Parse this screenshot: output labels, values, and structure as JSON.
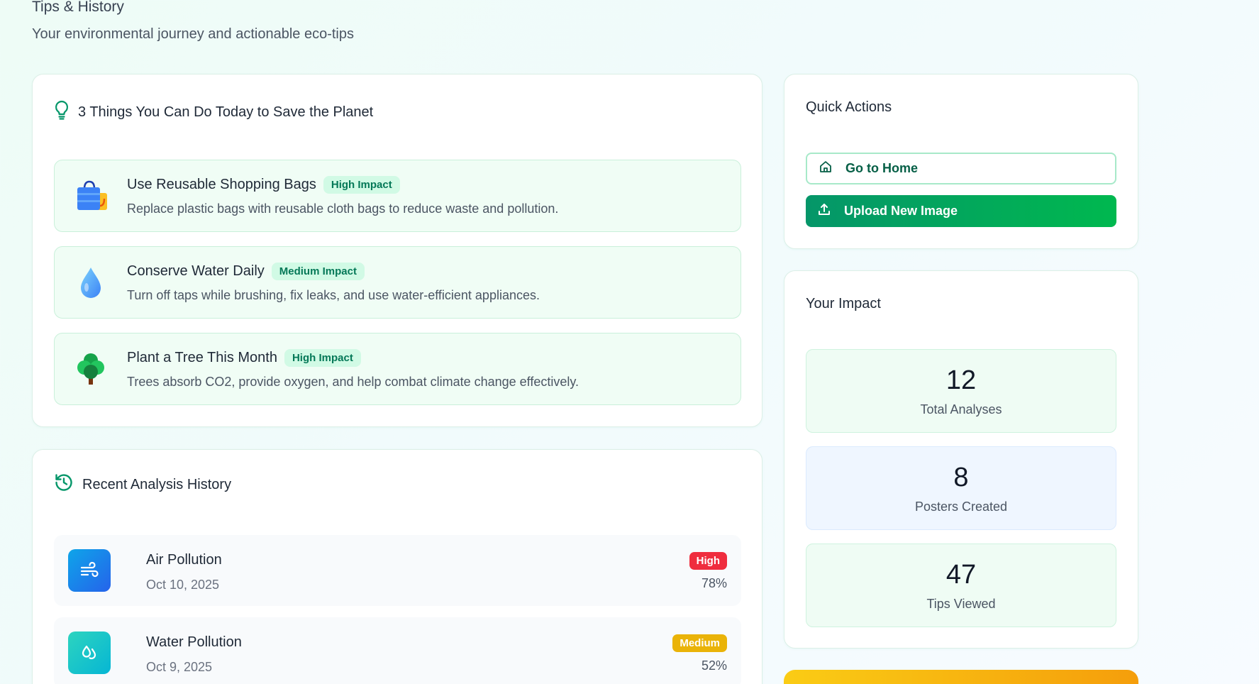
{
  "header": {
    "title": "Tips & History",
    "subtitle": "Your environmental journey and actionable eco-tips"
  },
  "tips": {
    "title": "3 Things You Can Do Today to Save the Planet",
    "items": [
      {
        "icon": "shopping-bags-icon",
        "title": "Use Reusable Shopping Bags",
        "badge": "High Impact",
        "description": "Replace plastic bags with reusable cloth bags to reduce waste and pollution."
      },
      {
        "icon": "water-drop-icon",
        "title": "Conserve Water Daily",
        "badge": "Medium Impact",
        "description": "Turn off taps while brushing, fix leaks, and use water-efficient appliances."
      },
      {
        "icon": "tree-icon",
        "title": "Plant a Tree This Month",
        "badge": "High Impact",
        "description": "Trees absorb CO2, provide oxygen, and help combat climate change effectively."
      }
    ]
  },
  "history": {
    "title": "Recent Analysis History",
    "items": [
      {
        "icon": "wind-icon",
        "name": "Air Pollution",
        "date": "Oct 10, 2025",
        "severity": "High",
        "severity_color": "#ef2d3e",
        "percent": "78%"
      },
      {
        "icon": "droplets-icon",
        "name": "Water Pollution",
        "date": "Oct 9, 2025",
        "severity": "Medium",
        "severity_color": "#eab308",
        "percent": "52%"
      }
    ]
  },
  "quick_actions": {
    "title": "Quick Actions",
    "home_label": "Go to Home",
    "upload_label": "Upload New Image"
  },
  "impact": {
    "title": "Your Impact",
    "stats": [
      {
        "value": "12",
        "label": "Total Analyses"
      },
      {
        "value": "8",
        "label": "Posters Created"
      },
      {
        "value": "47",
        "label": "Tips Viewed"
      }
    ]
  },
  "colors": {
    "accent": "#059669",
    "badge_bg": "#d1fae5",
    "tip_bg": "#f0fdf5"
  }
}
